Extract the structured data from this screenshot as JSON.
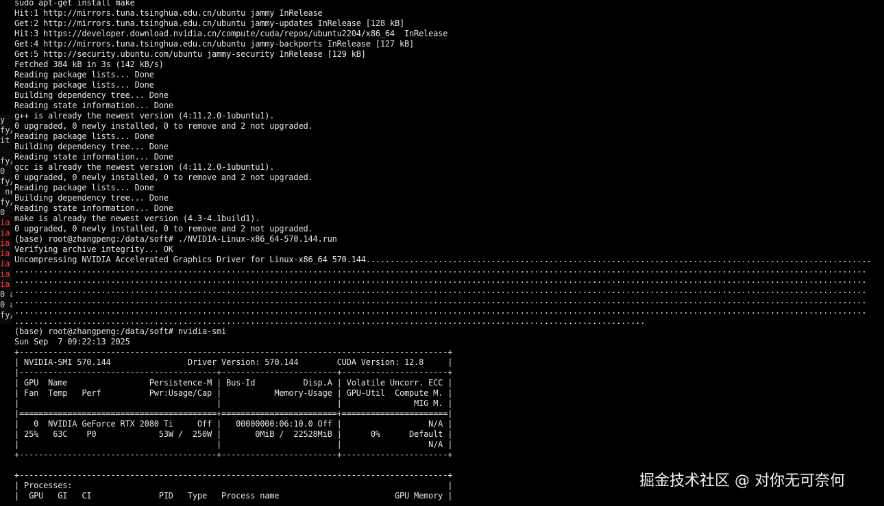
{
  "terminal": {
    "lines": [
      "sudo apt-get install make",
      "Hit:1 http://mirrors.tuna.tsinghua.edu.cn/ubuntu jammy InRelease",
      "Get:2 http://mirrors.tuna.tsinghua.edu.cn/ubuntu jammy-updates InRelease [128 kB]",
      "Hit:3 https://developer.download.nvidia.cn/compute/cuda/repos/ubuntu2204/x86_64  InRelease",
      "Get:4 http://mirrors.tuna.tsinghua.edu.cn/ubuntu jammy-backports InRelease [127 kB]",
      "Get:5 http://security.ubuntu.com/ubuntu jammy-security InRelease [129 kB]",
      "Fetched 384 kB in 3s (142 kB/s)",
      "Reading package lists... Done",
      "Reading package lists... Done",
      "Building dependency tree... Done",
      "Reading state information... Done",
      "g++ is already the newest version (4:11.2.0-1ubuntu1).",
      "0 upgraded, 0 newly installed, 0 to remove and 2 not upgraded.",
      "Reading package lists... Done",
      "Building dependency tree... Done",
      "Reading state information... Done",
      "gcc is already the newest version (4:11.2.0-1ubuntu1).",
      "0 upgraded, 0 newly installed, 0 to remove and 2 not upgraded.",
      "Reading package lists... Done",
      "Building dependency tree... Done",
      "Reading state information... Done",
      "make is already the newest version (4.3-4.1build1).",
      "0 upgraded, 0 newly installed, 0 to remove and 2 not upgraded.",
      "(base) root@zhangpeng:/data/soft# ./NVIDIA-Linux-x86_64-570.144.run",
      "Verifying archive integrity... OK",
      "Uncompressing NVIDIA Accelerated Graphics Driver for Linux-x86_64 570.144.........................................................................................................",
      ".................................................................................................................................................................................",
      ".................................................................................................................................................................................",
      ".................................................................................................................................................................................",
      ".................................................................................................................................................................................",
      ".................................................................................................................................................................................",
      "...................................................................................................................................",
      "(base) root@zhangpeng:/data/soft# nvidia-smi",
      "Sun Sep  7 09:22:13 2025",
      "+-----------------------------------------------------------------------------------------+",
      "| NVIDIA-SMI 570.144                Driver Version: 570.144        CUDA Version: 12.8     |",
      "|-----------------------------------------+------------------------+----------------------+",
      "| GPU  Name                 Persistence-M | Bus-Id          Disp.A | Volatile Uncorr. ECC |",
      "| Fan  Temp   Perf          Pwr:Usage/Cap |           Memory-Usage | GPU-Util  Compute M. |",
      "|                                         |                        |               MIG M. |",
      "|=========================================+========================+======================|",
      "|   0  NVIDIA GeForce RTX 2080 Ti     Off |   00000000:06:10.0 Off |                  N/A |",
      "| 25%   63C    P0             53W /  250W |       0MiB /  22528MiB |      0%      Default |",
      "|                                         |                        |                  N/A |",
      "+-----------------------------------------+------------------------+----------------------+",
      "",
      "+-----------------------------------------------------------------------------------------+",
      "| Processes:                                                                              |",
      "|  GPU   GI   CI              PID   Type   Process name                        GPU Memory |"
    ]
  },
  "left_panel": {
    "fragments": [
      {
        "text": "y",
        "color": "#cfcfcf"
      },
      {
        "text": "fy/",
        "color": "#cfcfcf"
      },
      {
        "text": "it",
        "color": "#cfcfcf"
      },
      {
        "text": "",
        "color": "#cfcfcf"
      },
      {
        "text": "fy/",
        "color": "#cfcfcf"
      },
      {
        "text": "0",
        "color": "#cfcfcf"
      },
      {
        "text": "fy/",
        "color": "#cfcfcf"
      },
      {
        "text": " nc",
        "color": "#cfcfcf"
      },
      {
        "text": "fy/",
        "color": "#cfcfcf"
      },
      {
        "text": "0",
        "color": "#cfcfcf"
      },
      {
        "text": "ia",
        "color": "#ff3b3b"
      },
      {
        "text": "ia",
        "color": "#ff3b3b"
      },
      {
        "text": "ia",
        "color": "#ff3b3b"
      },
      {
        "text": "ia",
        "color": "#ff3b3b"
      },
      {
        "text": "ia",
        "color": "#ff3b3b"
      },
      {
        "text": "ia",
        "color": "#ff3b3b"
      },
      {
        "text": "ia",
        "color": "#ff3b3b"
      },
      {
        "text": "0 a",
        "color": "#cfcfcf"
      },
      {
        "text": "0 a",
        "color": "#cfcfcf"
      },
      {
        "text": "fy/",
        "color": "#cfcfcf"
      }
    ]
  },
  "watermark": {
    "text": "掘金技术社区 @ 对你无可奈何"
  }
}
